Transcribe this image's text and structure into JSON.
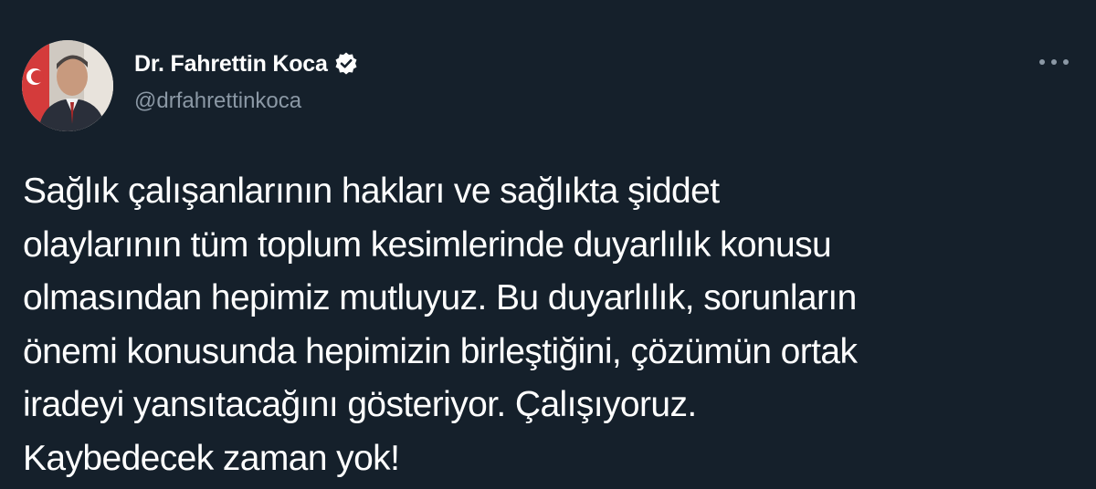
{
  "author": {
    "display_name": "Dr. Fahrettin Koca",
    "handle": "@drfahrettinkoca",
    "verified_icon": "verified-badge-icon",
    "avatar": "profile-photo"
  },
  "actions": {
    "more_icon": "more-options-icon"
  },
  "tweet": {
    "text": "Sağlık çalışanlarının hakları ve sağlıkta şiddet\nolaylarının tüm toplum kesimlerinde duyarlılık konusu\nolmasından hepimiz mutluyuz. Bu duyarlılık, sorunların\nönemi konusunda hepimizin birleştiğini, çözümün ortak\niradeyi yansıtacağını gösteriyor. Çalışıyoruz.\nKaybedecek zaman yok!"
  },
  "colors": {
    "background": "#15202b",
    "primary_text": "#ffffff",
    "secondary_text": "#8b98a5"
  }
}
